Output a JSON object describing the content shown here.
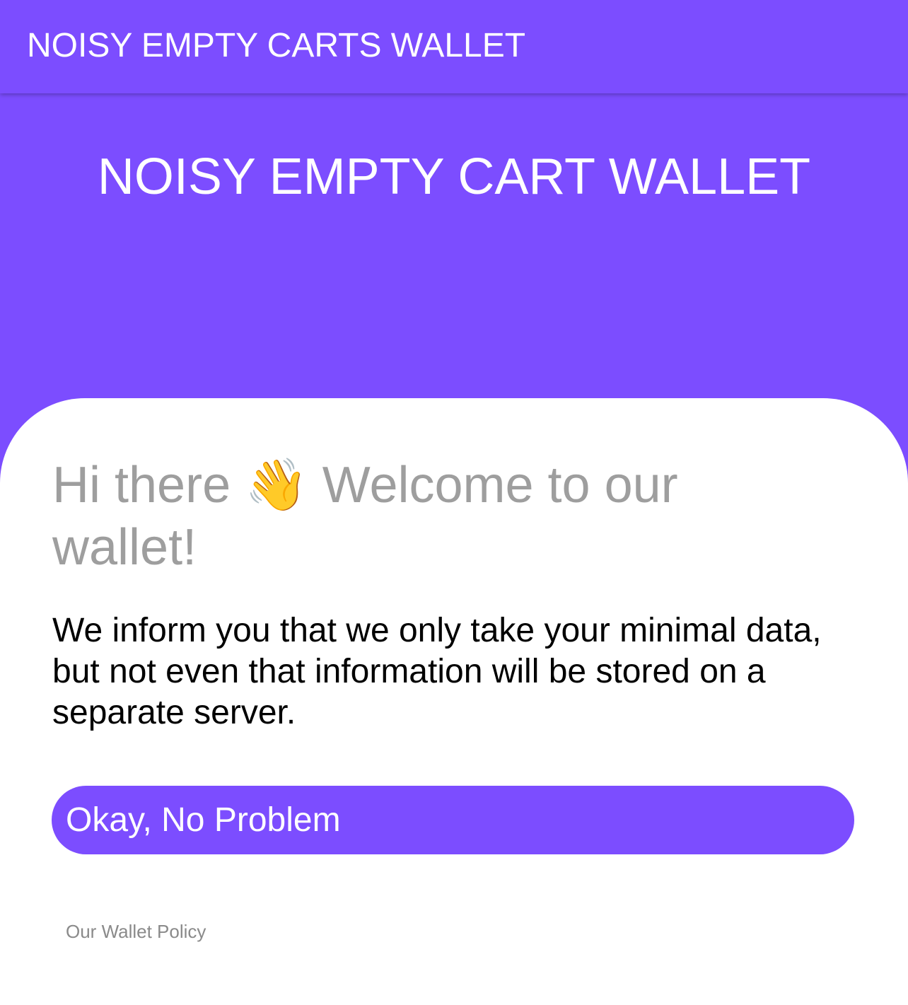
{
  "app_bar": {
    "title": "NOISY EMPTY CARTS WALLET"
  },
  "hero": {
    "title": "NOISY EMPTY CART WALLET"
  },
  "card": {
    "greeting_prefix": "Hi there",
    "greeting_emoji": "👋",
    "greeting_suffix": " Welcome to our wallet!",
    "message": "We inform you that we only take your minimal data, but not even that information will be stored on a separate server.",
    "button_label": "Okay, No Problem",
    "policy_link": "Our Wallet Policy"
  },
  "colors": {
    "primary": "#7c4dff",
    "surface": "#ffffff",
    "greeting_text": "#9e9e9e",
    "body_text": "#000000",
    "link_text": "#8a8a8a"
  },
  "icons": {
    "greeting_icon": "waving-hand-icon"
  }
}
